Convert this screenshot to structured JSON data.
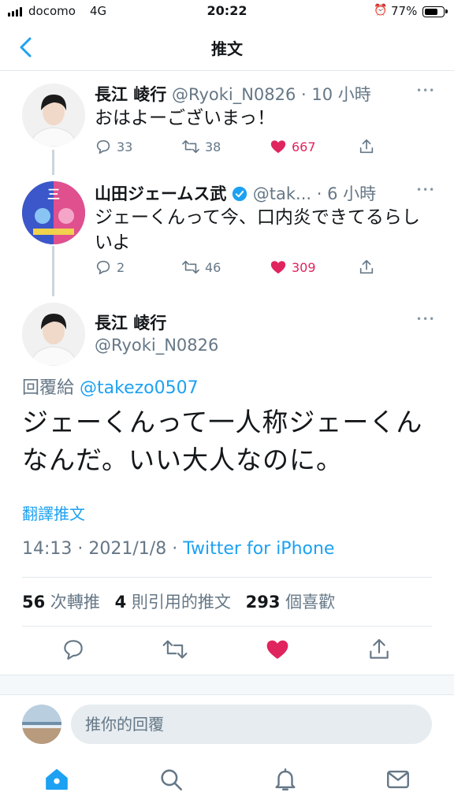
{
  "status_bar": {
    "carrier": "docomo",
    "network": "4G",
    "time": "20:22",
    "battery": "77%",
    "battery_level": 0.77
  },
  "nav": {
    "title": "推文"
  },
  "thread": [
    {
      "name": "長江 崚行",
      "handle": "@Ryoki_N0826",
      "time": "10 小時",
      "text": "おはよーございまっ！",
      "replies": "33",
      "retweets": "38",
      "likes": "667"
    },
    {
      "name": "山田ジェームス武",
      "handle": "@tak...",
      "time": "6 小時",
      "text": "ジェーくんって今、口内炎できてるらしいよ",
      "replies": "2",
      "retweets": "46",
      "likes": "309",
      "avatar_text": "三"
    }
  ],
  "focal": {
    "name": "長江 崚行",
    "handle": "@Ryoki_N0826",
    "reply_prefix": "回覆給",
    "reply_mention": "@takezo0507",
    "text": "ジェーくんって一人称ジェーくんなんだ。いい大人なのに。",
    "translate": "翻譯推文",
    "time": "14:13",
    "date": "2021/1/8",
    "source": "Twitter for iPhone",
    "retweet_count": "56",
    "retweet_label": "次轉推",
    "quote_count": "4",
    "quote_label": "則引用的推文",
    "like_count": "293",
    "like_label": "個喜歡"
  },
  "compose": {
    "placeholder": "推你的回覆"
  },
  "colors": {
    "accent": "#1da1f2",
    "like": "#e0245e",
    "muted": "#657786",
    "verified": "#1da1f2"
  },
  "icons": {
    "reply": "reply-icon",
    "retweet": "retweet-icon",
    "like": "heart-icon",
    "share": "share-icon",
    "home": "home-icon",
    "search": "search-icon",
    "notifications": "bell-icon",
    "messages": "mail-icon"
  }
}
